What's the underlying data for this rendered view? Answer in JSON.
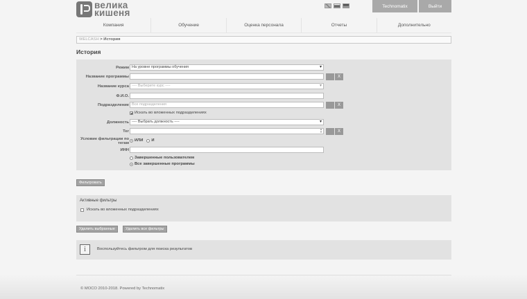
{
  "header": {
    "logo_line1": "велика",
    "logo_line2": "кишеня",
    "company_button": "Technomatix",
    "logout_button": "Выйти",
    "flags": [
      "gb-flag-icon",
      "ru-flag-icon",
      "ua-flag-icon"
    ]
  },
  "nav": {
    "items": [
      "Компания",
      "Обучение",
      "Оценка персонала",
      "Отчеты",
      "Дополнительно"
    ]
  },
  "breadcrumb": {
    "root": "WELCASH",
    "separator": " > ",
    "current": "История"
  },
  "page_title": "История",
  "filters": {
    "mode_label": "Режим",
    "mode_value": "На уровне программы обучения",
    "program_label": "Название программы",
    "program_value": "",
    "course_label": "Название курса",
    "course_value": "---- Выберите курс ----",
    "fio_label": "Ф.И.О.",
    "fio_value": "",
    "division_label": "Подразделение",
    "division_placeholder": "Все подразделения",
    "nested_label": "Искать во вложенных подразделениях",
    "position_label": "Должность",
    "position_value": "---- Выбрать должность ----",
    "tag_label": "Тег",
    "tag_condition_label": "Условие фильтрации по тегам",
    "tag_or": "ИЛИ",
    "tag_and": "И",
    "inn_label": "ИНН",
    "completed_users": "Завершенные пользователем",
    "all_completed": "Все завершенные программы",
    "clear_btn": "X"
  },
  "actions": {
    "filter_button": "Фильтровать",
    "delete_selected": "Удалить выбранные",
    "delete_all": "Удалить все фильтры"
  },
  "active_filters": {
    "title": "Активные фильтры",
    "items": [
      "Искать во вложенных подразделениях"
    ]
  },
  "info": {
    "icon": "i",
    "text": "Воспользуйтесь фильтром для поиска результатов"
  },
  "footer": {
    "text": "© MOCO 2010-2018. Powered by Technomatix"
  }
}
